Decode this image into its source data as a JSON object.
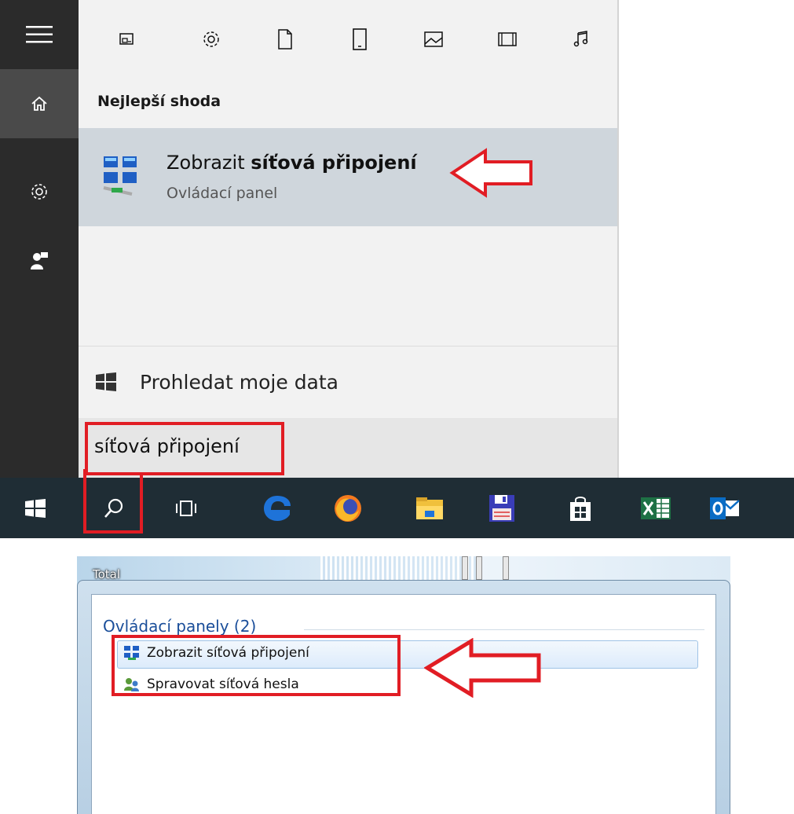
{
  "start_menu": {
    "filters": [
      "apps-icon",
      "settings-icon",
      "documents-icon",
      "tablet-icon",
      "photos-icon",
      "videos-icon",
      "music-icon"
    ],
    "best_match_label": "Nejlepší shoda",
    "best_match": {
      "title_prefix": "Zobrazit ",
      "title_bold": "síťová připojení",
      "subtitle": "Ovládací panel"
    },
    "search_my_data": "Prohledat moje data",
    "query": "síťová připojení"
  },
  "win7_popup": {
    "desktop_label": "Total",
    "category": "Ovládací panely (2)",
    "items": [
      {
        "label": "Zobrazit síťová připojení"
      },
      {
        "label": "Spravovat síťová hesla"
      }
    ]
  },
  "colors": {
    "annotation_red": "#e11d24",
    "rail": "#2b2b2b",
    "taskbar": "#1f2d35",
    "selected_row": "#cfd6dc"
  }
}
